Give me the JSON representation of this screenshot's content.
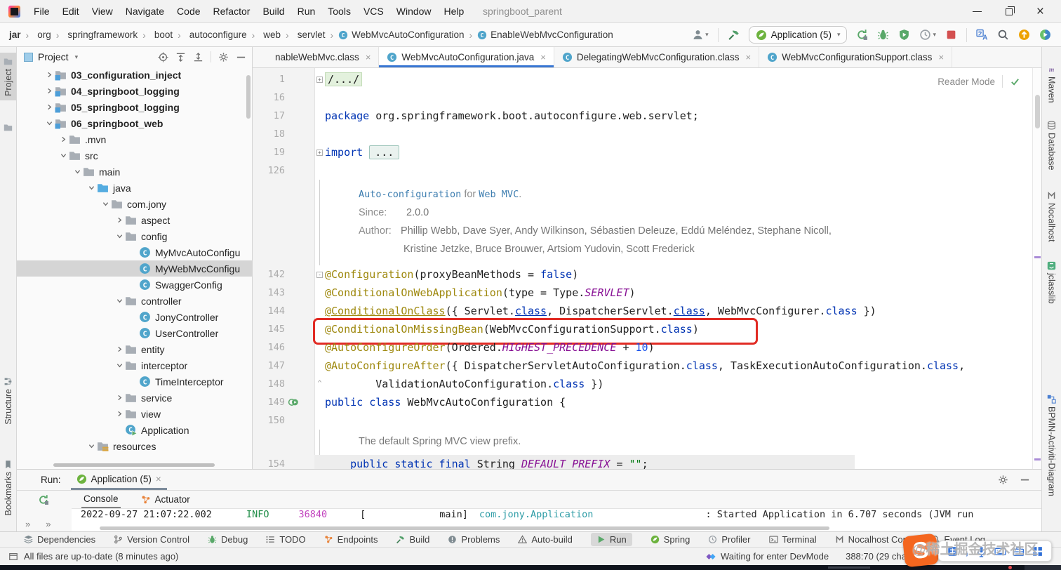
{
  "window": {
    "title": "springboot_parent"
  },
  "colors": {
    "accent": "#3876D3",
    "highlight_box": "#E12B24",
    "run_green": "#59A869",
    "stop_red": "#D35050",
    "keyword": "#0033B3",
    "annotation": "#9E880D",
    "string": "#067D17",
    "sogou_orange": "#F4661F"
  },
  "menu_items": [
    {
      "label": "File"
    },
    {
      "label": "Edit"
    },
    {
      "label": "View"
    },
    {
      "label": "Navigate"
    },
    {
      "label": "Code"
    },
    {
      "label": "Refactor"
    },
    {
      "label": "Build"
    },
    {
      "label": "Run"
    },
    {
      "label": "Tools"
    },
    {
      "label": "VCS"
    },
    {
      "label": "Window"
    },
    {
      "label": "Help"
    }
  ],
  "breadcrumbs": [
    {
      "label": "jar",
      "bold": true
    },
    {
      "label": "org"
    },
    {
      "label": "springframework"
    },
    {
      "label": "boot"
    },
    {
      "label": "autoconfigure"
    },
    {
      "label": "web"
    },
    {
      "label": "servlet"
    },
    {
      "label": "WebMvcAutoConfiguration",
      "icon": "class"
    },
    {
      "label": "EnableWebMvcConfiguration",
      "icon": "class"
    }
  ],
  "toolbar": {
    "run_config": "Application (5)",
    "icon_names": [
      "user",
      "build-hammer",
      "spring-boot-run-config",
      "rerun",
      "debug",
      "run-with-coverage",
      "profiler",
      "stop",
      "translate",
      "search-everywhere",
      "ide-update",
      "plugin"
    ]
  },
  "project_panel": {
    "title": "Project",
    "icon_names": [
      "locate",
      "expand-all",
      "collapse-all",
      "settings",
      "hide"
    ]
  },
  "tree": {
    "items": [
      {
        "label": "03_configuration_inject",
        "depth": 0,
        "expand": "closed",
        "icon": "module-folder",
        "bold": true
      },
      {
        "label": "04_springboot_logging",
        "depth": 0,
        "expand": "closed",
        "icon": "module-folder",
        "bold": true
      },
      {
        "label": "05_springboot_logging",
        "depth": 0,
        "expand": "closed",
        "icon": "module-folder",
        "bold": true
      },
      {
        "label": "06_springboot_web",
        "depth": 0,
        "expand": "open",
        "icon": "module-folder",
        "bold": true
      },
      {
        "label": ".mvn",
        "depth": 1,
        "expand": "closed",
        "icon": "folder"
      },
      {
        "label": "src",
        "depth": 1,
        "expand": "open",
        "icon": "folder"
      },
      {
        "label": "main",
        "depth": 2,
        "expand": "open",
        "icon": "folder"
      },
      {
        "label": "java",
        "depth": 3,
        "expand": "open",
        "icon": "source-folder"
      },
      {
        "label": "com.jony",
        "depth": 4,
        "expand": "open",
        "icon": "folder"
      },
      {
        "label": "aspect",
        "depth": 5,
        "expand": "closed",
        "icon": "folder"
      },
      {
        "label": "config",
        "depth": 5,
        "expand": "open",
        "icon": "folder"
      },
      {
        "label": "MyMvcAutoConfigu",
        "depth": 6,
        "icon": "class"
      },
      {
        "label": "MyWebMvcConfigu",
        "depth": 6,
        "icon": "class",
        "selected": true
      },
      {
        "label": "SwaggerConfig",
        "depth": 6,
        "icon": "class"
      },
      {
        "label": "controller",
        "depth": 5,
        "expand": "open",
        "icon": "folder"
      },
      {
        "label": "JonyController",
        "depth": 6,
        "icon": "class"
      },
      {
        "label": "UserController",
        "depth": 6,
        "icon": "class"
      },
      {
        "label": "entity",
        "depth": 5,
        "expand": "closed",
        "icon": "folder"
      },
      {
        "label": "interceptor",
        "depth": 5,
        "expand": "open",
        "icon": "folder"
      },
      {
        "label": "TimeInterceptor",
        "depth": 6,
        "icon": "class"
      },
      {
        "label": "service",
        "depth": 5,
        "expand": "closed",
        "icon": "folder"
      },
      {
        "label": "view",
        "depth": 5,
        "expand": "closed",
        "icon": "folder"
      },
      {
        "label": "Application",
        "depth": 5,
        "icon": "run-class"
      },
      {
        "label": "resources",
        "depth": 3,
        "expand": "open",
        "icon": "resources-folder"
      }
    ]
  },
  "tabs": [
    {
      "label": "nableWebMvc.class",
      "icon": ""
    },
    {
      "label": "WebMvcAutoConfiguration.java",
      "icon": "class",
      "active": true
    },
    {
      "label": "DelegatingWebMvcConfiguration.class",
      "icon": "class"
    },
    {
      "label": "WebMvcConfigurationSupport.class",
      "icon": "class"
    }
  ],
  "editor": {
    "reader_mode": "Reader Mode",
    "lines": [
      {
        "kind": "code",
        "num": "1",
        "fold": "box",
        "segs": [
          {
            "t": "/.../",
            "c": "fold"
          }
        ]
      },
      {
        "kind": "code",
        "num": "16",
        "segs": []
      },
      {
        "kind": "code",
        "num": "17",
        "segs": [
          {
            "t": "package ",
            "c": "kw"
          },
          {
            "t": "org.springframework.boot.autoconfigure.web.servlet;",
            "c": "plain"
          }
        ]
      },
      {
        "kind": "code",
        "num": "18",
        "segs": []
      },
      {
        "kind": "code",
        "num": "19",
        "fold": "box",
        "segs": [
          {
            "t": "import ",
            "c": "kw"
          },
          {
            "t": "...",
            "c": "foldbox"
          }
        ]
      },
      {
        "kind": "code",
        "num": "126",
        "segs": []
      },
      {
        "kind": "doc",
        "rows": [
          {
            "segs": [
              {
                "t": "Auto-configuration",
                "c": "doccode"
              },
              {
                "t": " for ",
                "c": "docplain"
              },
              {
                "t": "Web MVC",
                "c": "doccode"
              },
              {
                "t": ".",
                "c": "docplain"
              }
            ]
          },
          {
            "segs": [
              {
                "t": "Since:",
                "c": "doclabel"
              },
              {
                "t": "2.0.0",
                "c": "docval ml"
              }
            ]
          },
          {
            "segs": [
              {
                "t": "Author:",
                "c": "doclabel"
              },
              {
                "t": " Phillip Webb, Dave Syer, Andy Wilkinson, Sébastien Deleuze, Eddú Meléndez, Stephane Nicoll,",
                "c": "docval"
              }
            ]
          },
          {
            "indent": true,
            "segs": [
              {
                "t": "Kristine Jetzke, Bruce Brouwer, Artsiom Yudovin, Scott Frederick",
                "c": "docval"
              }
            ]
          }
        ]
      },
      {
        "kind": "code",
        "num": "142",
        "fold": "minus",
        "segs": [
          {
            "t": "@Configuration",
            "c": "ann"
          },
          {
            "t": "(proxyBeanMethods = ",
            "c": "plain"
          },
          {
            "t": "false",
            "c": "kw"
          },
          {
            "t": ")",
            "c": "plain"
          }
        ]
      },
      {
        "kind": "code",
        "num": "143",
        "segs": [
          {
            "t": "@ConditionalOnWebApplication",
            "c": "ann"
          },
          {
            "t": "(type = Type.",
            "c": "plain"
          },
          {
            "t": "SERVLET",
            "c": "static"
          },
          {
            "t": ")",
            "c": "plain"
          }
        ]
      },
      {
        "kind": "code",
        "num": "144",
        "segs": [
          {
            "t": "@ConditionalOnClass",
            "c": "ann u"
          },
          {
            "t": "({ Servlet.",
            "c": "plain"
          },
          {
            "t": "class",
            "c": "kw u"
          },
          {
            "t": ", DispatcherServlet.",
            "c": "plain"
          },
          {
            "t": "class",
            "c": "kw u"
          },
          {
            "t": ", WebMvcConfigurer.",
            "c": "plain"
          },
          {
            "t": "class",
            "c": "kw"
          },
          {
            "t": " })",
            "c": "plain"
          }
        ]
      },
      {
        "kind": "code",
        "num": "145",
        "boxed": true,
        "segs": [
          {
            "t": "@ConditionalOnMissingBean",
            "c": "ann"
          },
          {
            "t": "(WebMvcConfigurationSupport.",
            "c": "plain"
          },
          {
            "t": "class",
            "c": "kw"
          },
          {
            "t": ")",
            "c": "plain"
          }
        ]
      },
      {
        "kind": "code",
        "num": "146",
        "segs": [
          {
            "t": "@AutoConfigureOrder",
            "c": "ann"
          },
          {
            "t": "(Ordered.",
            "c": "plain"
          },
          {
            "t": "HIGHEST_PRECEDENCE",
            "c": "static"
          },
          {
            "t": " + ",
            "c": "plain"
          },
          {
            "t": "10",
            "c": "numlit"
          },
          {
            "t": ")",
            "c": "plain"
          }
        ]
      },
      {
        "kind": "code",
        "num": "147",
        "segs": [
          {
            "t": "@AutoConfigureAfter",
            "c": "ann"
          },
          {
            "t": "({ DispatcherServletAutoConfiguration.",
            "c": "plain"
          },
          {
            "t": "class",
            "c": "kw"
          },
          {
            "t": ", TaskExecutionAutoConfiguration.",
            "c": "plain"
          },
          {
            "t": "class",
            "c": "kw"
          },
          {
            "t": ",",
            "c": "plain"
          }
        ]
      },
      {
        "kind": "code",
        "num": "148",
        "fold": "up",
        "segs": [
          {
            "t": "        ValidationAutoConfiguration.",
            "c": "plain"
          },
          {
            "t": "class",
            "c": "kw"
          },
          {
            "t": " })",
            "c": "plain"
          }
        ]
      },
      {
        "kind": "code",
        "num": "149",
        "run": true,
        "segs": [
          {
            "t": "public class ",
            "c": "kw"
          },
          {
            "t": "WebMvcAutoConfiguration {",
            "c": "plain"
          }
        ]
      },
      {
        "kind": "code",
        "num": "150",
        "segs": []
      },
      {
        "kind": "doc",
        "d2": true,
        "rows": [
          {
            "segs": [
              {
                "t": "The default Spring MVC view prefix.",
                "c": "docval"
              }
            ]
          }
        ]
      },
      {
        "kind": "code",
        "num": "154",
        "hl": true,
        "segs": [
          {
            "t": "    ",
            "c": "plain"
          },
          {
            "t": "public static final ",
            "c": "kw"
          },
          {
            "t": "String ",
            "c": "plain"
          },
          {
            "t": "DEFAULT_PREFIX",
            "c": "static"
          },
          {
            "t": " = ",
            "c": "plain"
          },
          {
            "t": "\"\"",
            "c": "str"
          },
          {
            "t": ";",
            "c": "plain"
          }
        ]
      }
    ]
  },
  "run_panel": {
    "label": "Run:",
    "tab": "Application (5)",
    "tabs": [
      {
        "label": "Console",
        "active": true
      },
      {
        "label": "Actuator",
        "icon": "endpoints"
      }
    ],
    "log": {
      "timestamp": "2022-09-27 21:07:22.002",
      "level": "INFO",
      "pid": "36840",
      "bracket": "[",
      "thread": "main]",
      "logger": "com.jony.Application",
      "message": ": Started Application in 6.707 seconds (JVM run"
    }
  },
  "bottom_bar": {
    "items": [
      {
        "label": "Dependencies",
        "icon": "layers"
      },
      {
        "label": "Version Control",
        "icon": "branch"
      },
      {
        "label": "Debug",
        "icon": "bug"
      },
      {
        "label": "TODO",
        "icon": "todo"
      },
      {
        "label": "Endpoints",
        "icon": "endpoints"
      },
      {
        "label": "Build",
        "icon": "hammer"
      },
      {
        "label": "Problems",
        "icon": "problem"
      },
      {
        "label": "Auto-build",
        "icon": "warn"
      },
      {
        "label": "Run",
        "icon": "play",
        "active": true
      },
      {
        "label": "Spring",
        "icon": "spring"
      },
      {
        "label": "Profiler",
        "icon": "clock"
      },
      {
        "label": "Terminal",
        "icon": "terminal"
      },
      {
        "label": "Nocalhost Cons",
        "icon": "nocalhost"
      },
      {
        "label": "Event Log",
        "icon": "bell"
      }
    ]
  },
  "status_bar": {
    "left": "All files are up-to-date (8 minutes ago)",
    "devmode": "Waiting for enter DevMode",
    "caret": "388:70 (29 chars)",
    "watermark": "@稀土掘金技术社区",
    "ime": {
      "logo": "S",
      "icon_names": [
        "chinese-english-toggle",
        "punctuation",
        "microphone",
        "keyboard",
        "toolbox",
        "apps-grid"
      ]
    }
  },
  "stripes": {
    "left": [
      {
        "label": "Project",
        "selected": true
      },
      {
        "label": "Structure"
      },
      {
        "label": "Bookmarks"
      }
    ],
    "right": [
      {
        "label": "Maven"
      },
      {
        "label": "Database"
      },
      {
        "label": "Nocalhost"
      },
      {
        "label": "jclasslib"
      },
      {
        "label": "BPMN-Activiti-Diagram"
      }
    ]
  }
}
